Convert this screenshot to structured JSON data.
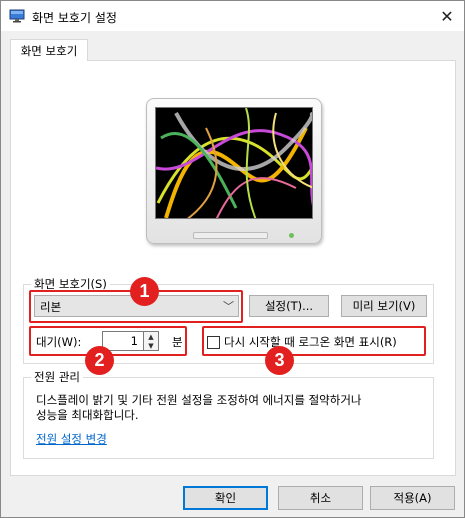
{
  "window": {
    "title": "화면 보호기 설정",
    "close_glyph": "✕"
  },
  "tab": {
    "label": "화면 보호기"
  },
  "screensaver": {
    "group_label": "화면 보호기(S)",
    "selected": "리본",
    "settings_button": "설정(T)...",
    "preview_button": "미리 보기(V)"
  },
  "wait": {
    "label": "대기(W):",
    "value": "1",
    "unit": "분"
  },
  "resume": {
    "checkbox_label": "다시 시작할 때 로그온 화면 표시(R)",
    "checked": false
  },
  "power": {
    "group_label": "전원 관리",
    "description_line1": "디스플레이 밝기 및 기타 전원 설정을 조정하여 에너지를 절약하거나",
    "description_line2": "성능을 최대화합니다.",
    "link": "전원 설정 변경"
  },
  "buttons": {
    "ok": "확인",
    "cancel": "취소",
    "apply": "적용(A)"
  },
  "annotations": {
    "badge1": "1",
    "badge2": "2",
    "badge3": "3",
    "color": "#e32020"
  }
}
